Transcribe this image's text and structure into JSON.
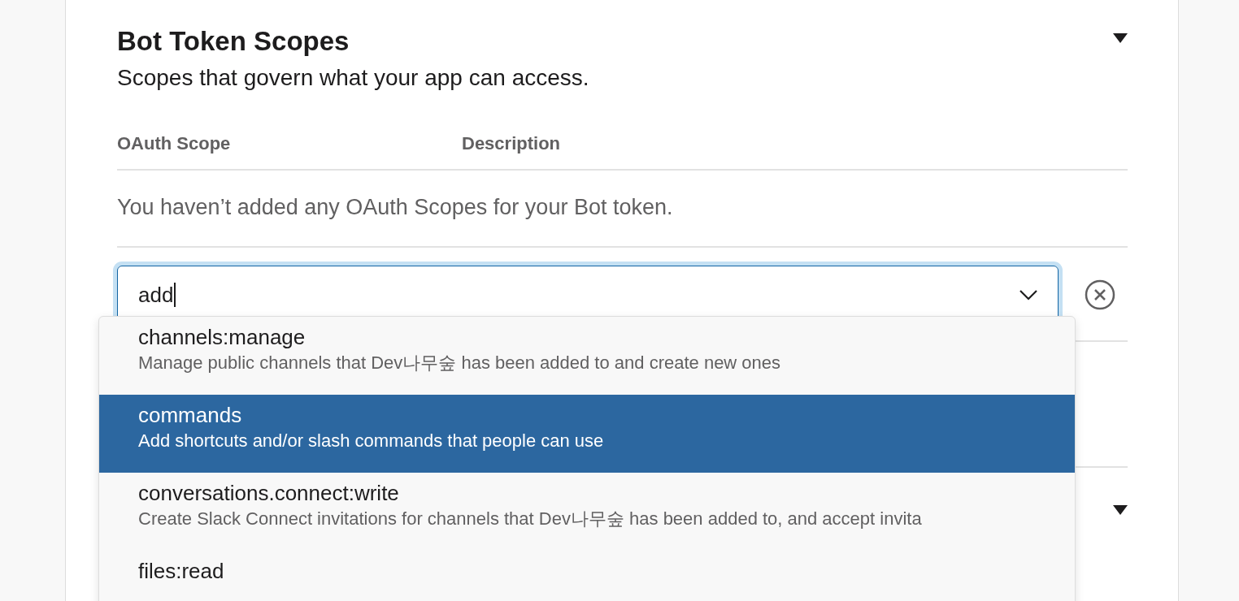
{
  "section": {
    "title": "Bot Token Scopes",
    "expanded": true,
    "subtitle": "Scopes that govern what your app can access."
  },
  "table": {
    "columns": [
      "OAuth Scope",
      "Description"
    ],
    "empty_message": "You haven’t added any OAuth Scopes for your Bot token."
  },
  "scope_picker": {
    "value": "add",
    "focused": true,
    "options": [
      {
        "name": "channels:manage",
        "description": "Manage public channels that Dev나무숲 has been added to and create new ones",
        "selected": false
      },
      {
        "name": "commands",
        "description": "Add shortcuts and/or slash commands that people can use",
        "selected": true
      },
      {
        "name": "conversations.connect:write",
        "description": "Create Slack Connect invitations for channels that Dev나무숲 has been added to, and accept invita",
        "selected": false
      },
      {
        "name": "files:read",
        "selected": false
      }
    ]
  },
  "next_section": {
    "expanded": true
  }
}
